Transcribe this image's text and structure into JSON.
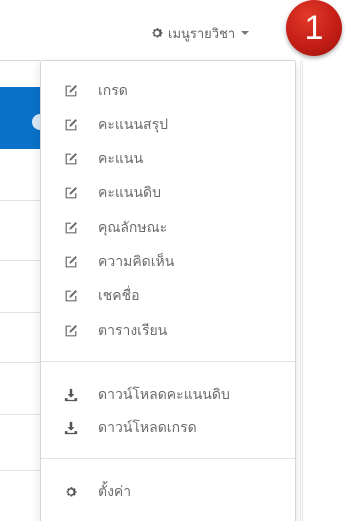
{
  "header": {
    "menu_label": "เมนูรายวิชา",
    "badge_number": "1"
  },
  "menu": {
    "edit_items": [
      {
        "label": "เกรด",
        "icon": "edit-icon"
      },
      {
        "label": "คะแนนสรุป",
        "icon": "edit-icon"
      },
      {
        "label": "คะแนน",
        "icon": "edit-icon"
      },
      {
        "label": "คะแนนดิบ",
        "icon": "edit-icon"
      },
      {
        "label": "คุณลักษณะ",
        "icon": "edit-icon"
      },
      {
        "label": "ความคิดเห็น",
        "icon": "edit-icon"
      },
      {
        "label": "เชคชื่อ",
        "icon": "edit-icon"
      },
      {
        "label": "ตารางเรียน",
        "icon": "edit-icon"
      }
    ],
    "download_items": [
      {
        "label": "ดาวน์โหลดคะแนนดิบ",
        "icon": "download-icon"
      },
      {
        "label": "ดาวน์โหลดเกรด",
        "icon": "download-icon"
      }
    ],
    "settings": {
      "label": "ตั้งค่า",
      "icon": "gear-icon"
    }
  },
  "colors": {
    "badge": "#c41e16",
    "accent_bar": "#0a72c9",
    "menu_text": "#6b6b6b"
  }
}
